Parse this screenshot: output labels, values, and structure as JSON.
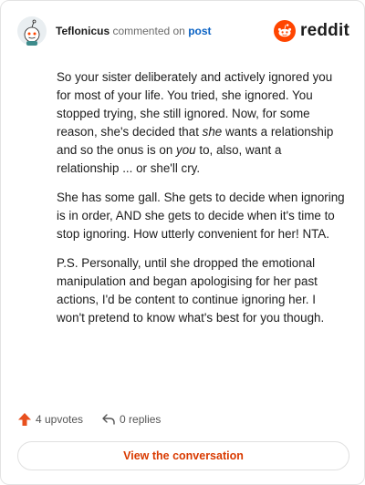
{
  "comment": {
    "username": "Teflonicus",
    "action_text": "commented on",
    "post_link": "post",
    "brand": "reddit",
    "paragraphs": [
      [
        {
          "t": "So your sister deliberately and actively ignored you for most of your life. You tried, she ignored. You stopped trying, she still ignored. Now, for some reason, she's decided that "
        },
        {
          "t": "she",
          "em": true
        },
        {
          "t": " wants a relationship and so the onus is on "
        },
        {
          "t": "you",
          "em": true
        },
        {
          "t": " to, also, want a relationship ... or she'll cry."
        }
      ],
      [
        {
          "t": "She has some gall. She gets to decide when ignoring is in order, AND she gets to decide when it's time to stop ignoring. How utterly convenient for her! NTA."
        }
      ],
      [
        {
          "t": "P.S. Personally, until she dropped the emotional manipulation and began apologising for her past actions, I'd be content to continue ignoring her. I won't pretend to know what's best for you though."
        }
      ]
    ]
  },
  "stats": {
    "upvotes": "4 upvotes",
    "replies": "0 replies"
  },
  "cta": {
    "label": "View the conversation"
  },
  "colors": {
    "brand_orange": "#ff4500",
    "link_blue": "#0a62c4",
    "cta_text": "#d93a00",
    "upvote_orange": "#e8501e"
  },
  "icons": {
    "avatar": "snoo-avatar-icon",
    "brand": "reddit-logo-icon",
    "upvote": "upvote-arrow-icon",
    "reply": "reply-arrow-icon"
  }
}
